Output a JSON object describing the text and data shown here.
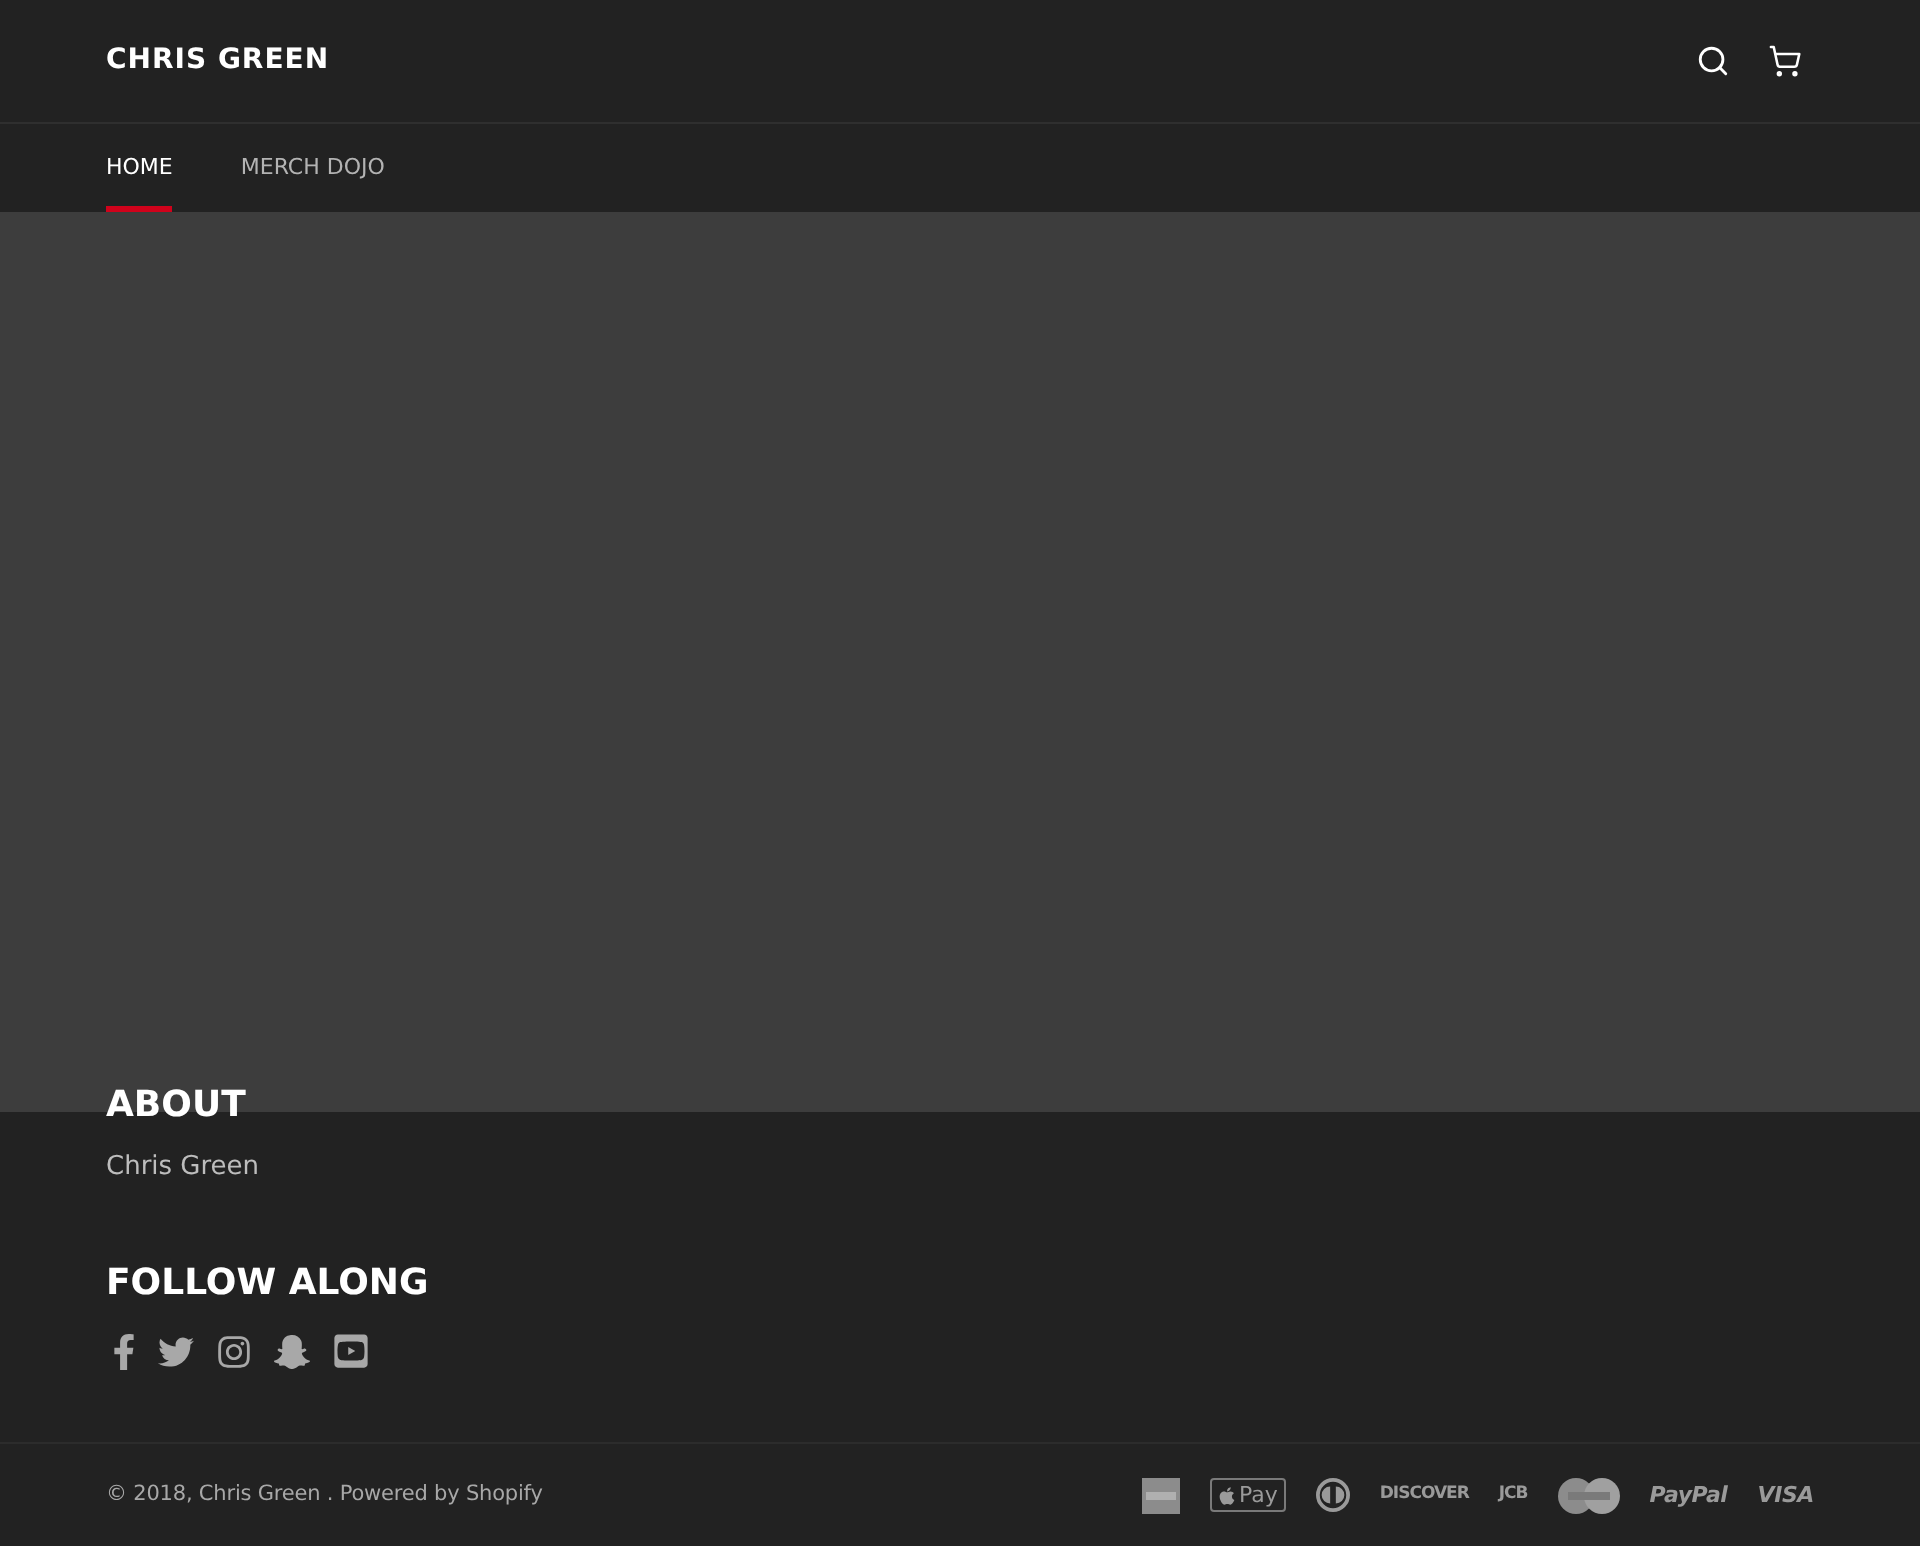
{
  "header": {
    "logo": "CHRIS GREEN",
    "icons": [
      {
        "kind": "search"
      },
      {
        "kind": "cart"
      }
    ]
  },
  "nav": [
    {
      "label": "HOME",
      "selected": true
    },
    {
      "label": "MERCH DOJO",
      "selected": false
    }
  ],
  "footer": {
    "about": {
      "heading": "ABOUT",
      "text": "Chris Green"
    },
    "follow": {
      "heading": "FOLLOW ALONG",
      "links": [
        {
          "kind": "facebook"
        },
        {
          "kind": "twitter"
        },
        {
          "kind": "instagram"
        },
        {
          "kind": "snapchat"
        },
        {
          "kind": "youtube"
        }
      ]
    },
    "copyright": "© 2018, Chris Green . Powered by Shopify",
    "payment_icons": [
      {
        "kind": "amex"
      },
      {
        "kind": "apple_pay",
        "label": "Pay"
      },
      {
        "kind": "diners"
      },
      {
        "kind": "wordmark",
        "label": "DISCOVER",
        "italic": false
      },
      {
        "kind": "wordmark",
        "label": "JCB",
        "italic": false
      },
      {
        "kind": "mastercard"
      },
      {
        "kind": "wordmark",
        "label": "PayPal",
        "italic": true
      },
      {
        "kind": "wordmark",
        "label": "VISA",
        "italic": true
      }
    ]
  }
}
